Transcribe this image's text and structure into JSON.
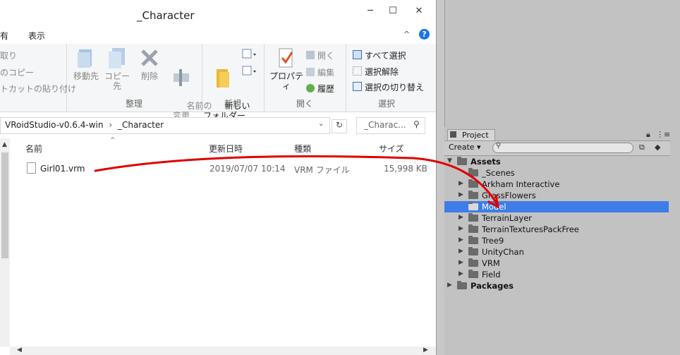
{
  "explorer": {
    "title": "_Character",
    "window_buttons": {
      "minimize": "─",
      "maximize": "☐",
      "close": "✕"
    },
    "tabs": [
      "有",
      "表示"
    ],
    "ribbon": {
      "clipboard_items": [
        "取り",
        "のコピー",
        "トカットの貼り付け"
      ],
      "organize": {
        "move_to": "移動先",
        "copy_to": "コピー先",
        "delete": "削除",
        "rename": "名前の\n変更",
        "label": "整理"
      },
      "new": {
        "new_folder": "新しい\nフォルダー",
        "label": "新規"
      },
      "open": {
        "properties": "プロパティ",
        "open": "開く",
        "edit": "編集",
        "history": "履歴",
        "label": "開く"
      },
      "select": {
        "select_all": "すべて選択",
        "select_none": "選択解除",
        "invert": "選択の切り替え",
        "label": "選択"
      }
    },
    "address": {
      "path_root": "VRoidStudio-v0.6.4-win",
      "separator": "›",
      "path_leaf": "_Character",
      "search_placeholder": "_Charac..."
    },
    "columns": {
      "name": "名前",
      "date": "更新日時",
      "type": "種類",
      "size": "サイズ"
    },
    "files": [
      {
        "name": "Girl01.vrm",
        "date": "2019/07/07 10:14",
        "type": "VRM ファイル",
        "size": "15,998 KB"
      }
    ]
  },
  "unity": {
    "tab_label": "Project",
    "create_label": "Create",
    "tree": [
      {
        "label": "Assets",
        "level": 0,
        "bold": true,
        "arrow": "▼"
      },
      {
        "label": "_Scenes",
        "level": 1,
        "arrow": ""
      },
      {
        "label": "Arkham Interactive",
        "level": 1,
        "arrow": "▶"
      },
      {
        "label": "GrassFlowers",
        "level": 1,
        "arrow": "▶"
      },
      {
        "label": "Model",
        "level": 1,
        "arrow": "",
        "selected": true
      },
      {
        "label": "TerrainLayer",
        "level": 1,
        "arrow": "▶"
      },
      {
        "label": "TerrainTexturesPackFree",
        "level": 1,
        "arrow": "▶"
      },
      {
        "label": "Tree9",
        "level": 1,
        "arrow": "▶"
      },
      {
        "label": "UnityChan",
        "level": 1,
        "arrow": "▶"
      },
      {
        "label": "VRM",
        "level": 1,
        "arrow": "▶"
      },
      {
        "label": "Field",
        "level": 1,
        "arrow": "▶"
      },
      {
        "label": "Packages",
        "level": 0,
        "bold": true,
        "arrow": "▶"
      }
    ]
  },
  "colors": {
    "selection": "#3e7de7",
    "annotation": "#e00000",
    "help": "#1a73e8"
  }
}
